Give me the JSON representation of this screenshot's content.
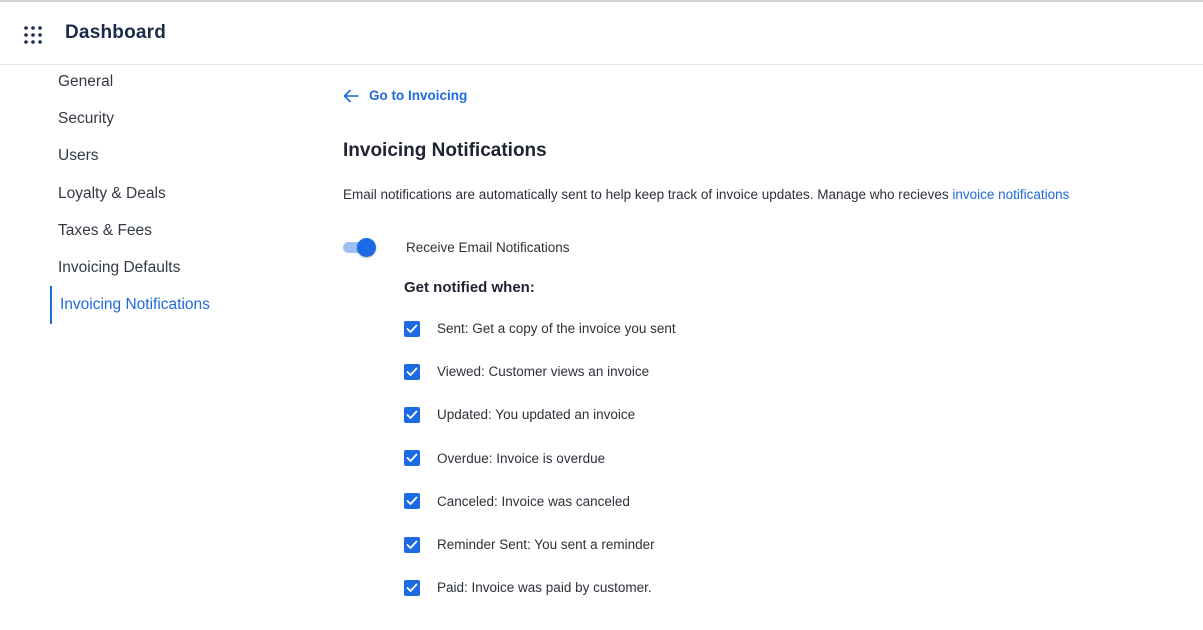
{
  "header": {
    "app_title": "Dashboard",
    "apps_icon": "grid-dots-icon"
  },
  "sidebar": {
    "items": [
      {
        "label": "General",
        "active": false
      },
      {
        "label": "Security",
        "active": false
      },
      {
        "label": "Users",
        "active": false
      },
      {
        "label": "Loyalty & Deals",
        "active": false
      },
      {
        "label": "Taxes & Fees",
        "active": false
      },
      {
        "label": "Invoicing Defaults",
        "active": false
      },
      {
        "label": "Invoicing Notifications",
        "active": true
      }
    ]
  },
  "main": {
    "back_link": {
      "label": "Go to Invoicing",
      "icon": "arrow-left-icon"
    },
    "title": "Invoicing Notifications",
    "description": {
      "text": "Email notifications are automatically sent to help keep track of invoice updates. Manage who recieves ",
      "link": "invoice notifications"
    },
    "email_toggle": {
      "label": "Receive Email Notifications",
      "on": true
    },
    "notify_heading": "Get notified when:",
    "options": [
      {
        "label": "Sent: Get a copy of the invoice you sent",
        "checked": true
      },
      {
        "label": "Viewed: Customer views an invoice",
        "checked": true
      },
      {
        "label": "Updated: You updated an invoice",
        "checked": true
      },
      {
        "label": "Overdue: Invoice is overdue",
        "checked": true
      },
      {
        "label": "Canceled: Invoice was canceled",
        "checked": true
      },
      {
        "label": "Reminder Sent: You sent a reminder",
        "checked": true
      },
      {
        "label": "Paid: Invoice was paid by customer.",
        "checked": true
      }
    ]
  },
  "colors": {
    "accent": "#1f6ad9",
    "toggle_knob": "#1d6ae5",
    "toggle_track": "#9dbff2",
    "title": "#1b2b4b"
  }
}
